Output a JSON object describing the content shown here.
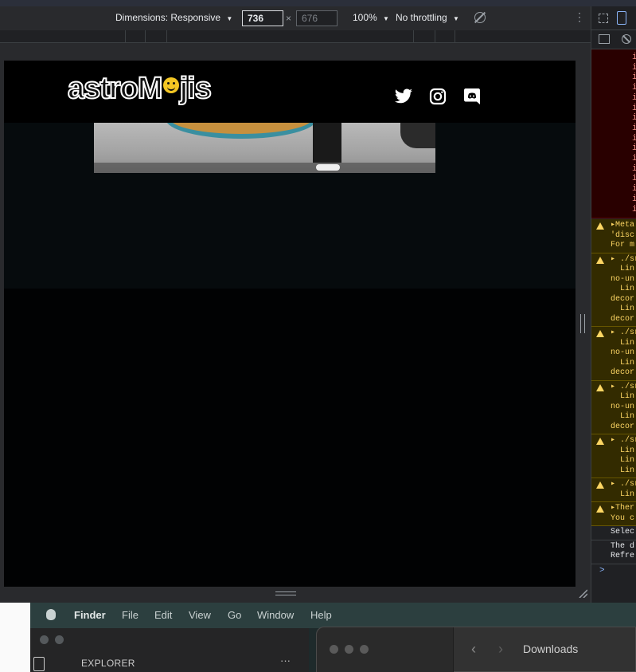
{
  "device_toolbar": {
    "dimensions_label": "Dimensions: Responsive",
    "width_value": "736",
    "height_value": "676",
    "times": "×",
    "zoom": "100%",
    "throttling": "No throttling",
    "dropdown_glyph": "▼",
    "more_glyph": "⋮"
  },
  "site": {
    "logo_text_left": "astroM",
    "logo_text_right": "jis",
    "social_icons": [
      "twitter-icon",
      "instagram-icon",
      "discord-icon"
    ]
  },
  "devtools": {
    "error_lines": [
      "i",
      "i",
      "i",
      "i",
      "i",
      "i",
      "i",
      "i",
      "i",
      "i",
      "i",
      "i",
      "i",
      "i",
      "i",
      "i"
    ],
    "messages": [
      {
        "type": "warn",
        "text": "▸Meta\n'disc\nFor m"
      },
      {
        "type": "warn",
        "text": "▸ ./sr\n  Lin\nno-un\n  Lin\ndecor\n  Lin\ndecor"
      },
      {
        "type": "warn",
        "text": "▸ ./sr\n  Lin\nno-un\n  Lin\ndecor"
      },
      {
        "type": "warn",
        "text": "▸ ./sr\n  Lin\nno-un\n  Lin\ndecor"
      },
      {
        "type": "warn",
        "text": "▸ ./sr\n  Lin\n  Lin\n  Lin"
      },
      {
        "type": "warn",
        "text": "▸ ./sr\n  Lin"
      },
      {
        "type": "warn",
        "text": "▸Ther\nYou c"
      },
      {
        "type": "info",
        "text": "Selec"
      },
      {
        "type": "info",
        "text": "The d\nRefre"
      }
    ],
    "prompt": ">"
  },
  "desktop": {
    "menubar": [
      "Finder",
      "File",
      "Edit",
      "View",
      "Go",
      "Window",
      "Help"
    ],
    "explorer_label": "EXPLORER",
    "explorer_more": "···",
    "finder_title": "Downloads",
    "nav_back": "‹",
    "nav_forward": "›"
  }
}
